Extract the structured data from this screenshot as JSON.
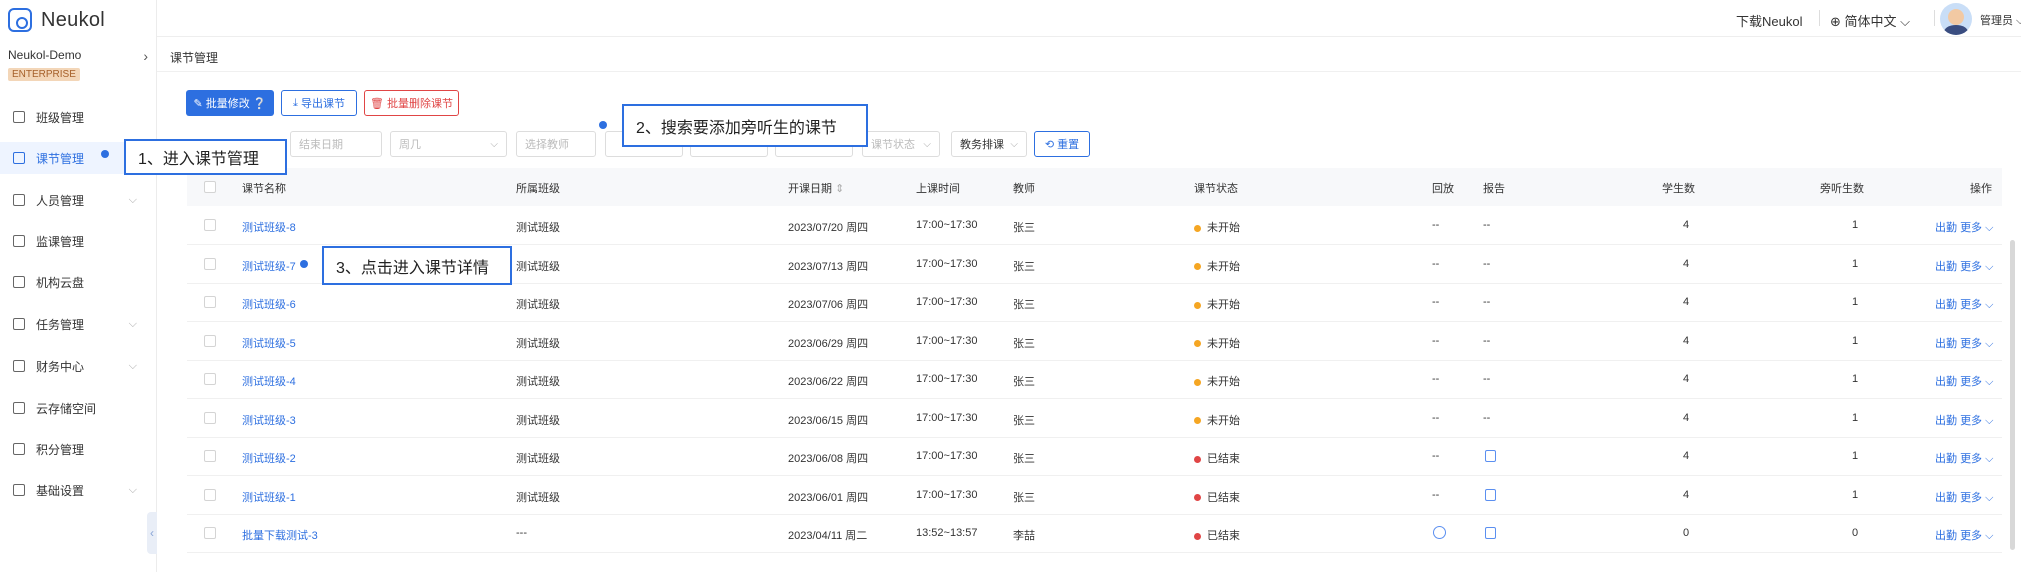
{
  "app": {
    "brand": "Neukol",
    "org": "Neukol-Demo",
    "edition": "ENTERPRISE"
  },
  "header": {
    "download": "下载Neukol",
    "language": "简体中文",
    "user": "管理员"
  },
  "sidebar": {
    "items": [
      {
        "label": "班级管理",
        "chevron": false
      },
      {
        "label": "课节管理",
        "chevron": false,
        "active": true
      },
      {
        "label": "人员管理",
        "chevron": true
      },
      {
        "label": "监课管理",
        "chevron": false
      },
      {
        "label": "机构云盘",
        "chevron": false
      },
      {
        "label": "任务管理",
        "chevron": true
      },
      {
        "label": "财务中心",
        "chevron": true
      },
      {
        "label": "云存储空间",
        "chevron": false
      },
      {
        "label": "积分管理",
        "chevron": false
      },
      {
        "label": "基础设置",
        "chevron": true
      }
    ]
  },
  "breadcrumb": "课节管理",
  "actions": {
    "batch_edit": "批量修改",
    "export": "导出课节",
    "batch_delete": "批量删除课节"
  },
  "filters": {
    "end_date": "结束日期",
    "weekday": "周几",
    "teacher": "选择教师",
    "status": "课节状态",
    "sort": "教务排课",
    "reset": "重置"
  },
  "table": {
    "headers": {
      "name": "课节名称",
      "class": "所属班级",
      "date": "开课日期",
      "time": "上课时间",
      "teacher": "教师",
      "status": "课节状态",
      "replay": "回放",
      "report": "报告",
      "students": "学生数",
      "auditors": "旁听生数",
      "actions": "操作"
    },
    "rows": [
      {
        "name": "测试班级-8",
        "class": "测试班级",
        "date": "2023/07/20 周四",
        "time": "17:00~17:30",
        "teacher": "张三",
        "status": "未开始",
        "status_color": "#f5a623",
        "replay": "--",
        "report": "--",
        "students": "4",
        "auditors": "1"
      },
      {
        "name": "测试班级-7",
        "class": "测试班级",
        "date": "2023/07/13 周四",
        "time": "17:00~17:30",
        "teacher": "张三",
        "status": "未开始",
        "status_color": "#f5a623",
        "replay": "--",
        "report": "--",
        "students": "4",
        "auditors": "1"
      },
      {
        "name": "测试班级-6",
        "class": "测试班级",
        "date": "2023/07/06 周四",
        "time": "17:00~17:30",
        "teacher": "张三",
        "status": "未开始",
        "status_color": "#f5a623",
        "replay": "--",
        "report": "--",
        "students": "4",
        "auditors": "1"
      },
      {
        "name": "测试班级-5",
        "class": "测试班级",
        "date": "2023/06/29 周四",
        "time": "17:00~17:30",
        "teacher": "张三",
        "status": "未开始",
        "status_color": "#f5a623",
        "replay": "--",
        "report": "--",
        "students": "4",
        "auditors": "1"
      },
      {
        "name": "测试班级-4",
        "class": "测试班级",
        "date": "2023/06/22 周四",
        "time": "17:00~17:30",
        "teacher": "张三",
        "status": "未开始",
        "status_color": "#f5a623",
        "replay": "--",
        "report": "--",
        "students": "4",
        "auditors": "1"
      },
      {
        "name": "测试班级-3",
        "class": "测试班级",
        "date": "2023/06/15 周四",
        "time": "17:00~17:30",
        "teacher": "张三",
        "status": "未开始",
        "status_color": "#f5a623",
        "replay": "--",
        "report": "--",
        "students": "4",
        "auditors": "1"
      },
      {
        "name": "测试班级-2",
        "class": "测试班级",
        "date": "2023/06/08 周四",
        "time": "17:00~17:30",
        "teacher": "张三",
        "status": "已结束",
        "status_color": "#e04545",
        "replay": "--",
        "report": "icon",
        "students": "4",
        "auditors": "1"
      },
      {
        "name": "测试班级-1",
        "class": "测试班级",
        "date": "2023/06/01 周四",
        "time": "17:00~17:30",
        "teacher": "张三",
        "status": "已结束",
        "status_color": "#e04545",
        "replay": "--",
        "report": "icon",
        "students": "4",
        "auditors": "1"
      },
      {
        "name": "批量下载测试-3",
        "class": "---",
        "date": "2023/04/11 周二",
        "time": "13:52~13:57",
        "teacher": "李喆",
        "status": "已结束",
        "status_color": "#e04545",
        "replay": "icon",
        "report": "icon",
        "students": "0",
        "auditors": "0"
      }
    ],
    "row_actions": {
      "attendance": "出勤",
      "more": "更多"
    }
  },
  "callouts": {
    "step1": "1、进入课节管理",
    "step2": "2、搜索要添加旁听生的课节",
    "step3": "3、点击进入课节详情"
  },
  "colors": {
    "accent": "#2d6fe0",
    "pending": "#f5a623",
    "ended": "#e04545"
  }
}
